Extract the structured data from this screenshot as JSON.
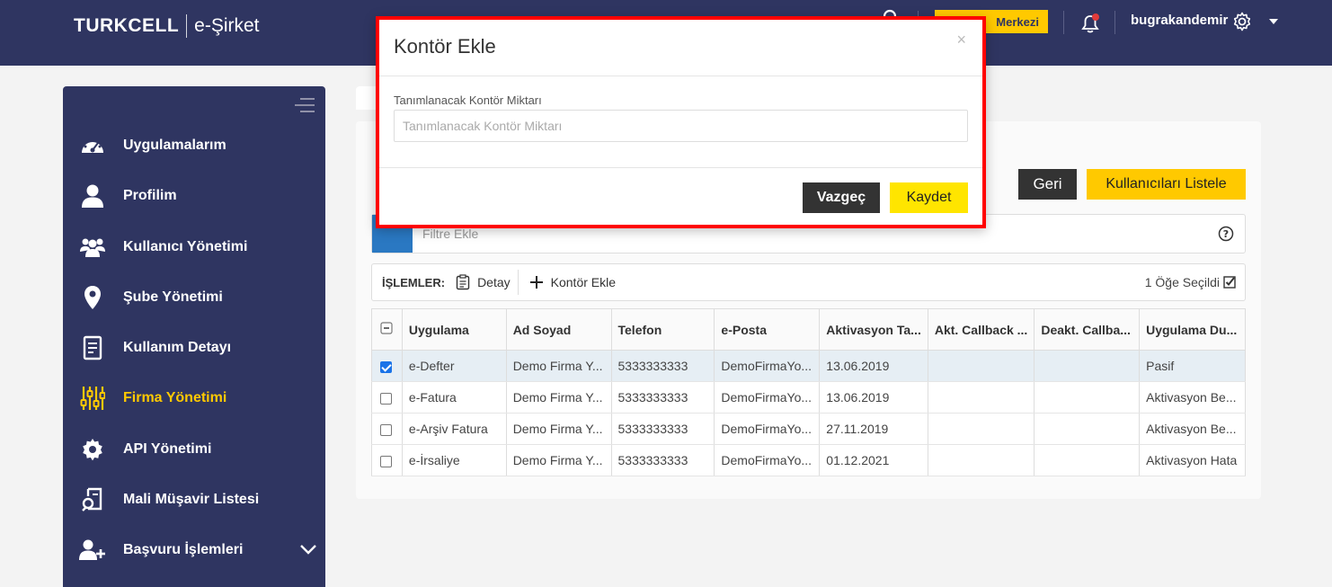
{
  "header": {
    "brand": "TURKCELL",
    "product": "e-Şirket",
    "support_label": "Merkezi",
    "username": "bugrakandemir"
  },
  "sidebar": {
    "items": [
      {
        "label": "Uygulamalarım",
        "icon": "dashboard-icon"
      },
      {
        "label": "Profilim",
        "icon": "user-icon"
      },
      {
        "label": "Kullanıcı Yönetimi",
        "icon": "users-icon"
      },
      {
        "label": "Şube Yönetimi",
        "icon": "map-pin-icon"
      },
      {
        "label": "Kullanım Detayı",
        "icon": "document-icon"
      },
      {
        "label": "Firma Yönetimi",
        "icon": "sliders-icon",
        "active": true
      },
      {
        "label": "API Yönetimi",
        "icon": "gear-icon"
      },
      {
        "label": "Mali Müşavir Listesi",
        "icon": "contract-icon"
      },
      {
        "label": "Başvuru İşlemleri",
        "icon": "user-plus-icon"
      }
    ]
  },
  "toolbar": {
    "back_label": "Geri",
    "list_users_label": "Kullanıcıları Listele",
    "filter_placeholder": "Filtre Ekle"
  },
  "operations": {
    "label": "İŞLEMLER:",
    "detail_label": "Detay",
    "add_credit_label": "Kontör Ekle",
    "selected_text": "1 Öğe Seçildi"
  },
  "table": {
    "columns": [
      "Uygulama",
      "Ad Soyad",
      "Telefon",
      "e-Posta",
      "Aktivasyon Ta...",
      "Akt. Callback ...",
      "Deakt. Callba...",
      "Uygulama Du..."
    ],
    "rows": [
      {
        "checked": true,
        "cells": [
          "e-Defter",
          "Demo Firma Y...",
          "5333333333",
          "DemoFirmaYo...",
          "13.06.2019",
          "",
          "",
          "Pasif"
        ]
      },
      {
        "checked": false,
        "cells": [
          "e-Fatura",
          "Demo Firma Y...",
          "5333333333",
          "DemoFirmaYo...",
          "13.06.2019",
          "",
          "",
          "Aktivasyon Be..."
        ]
      },
      {
        "checked": false,
        "cells": [
          "e-Arşiv Fatura",
          "Demo Firma Y...",
          "5333333333",
          "DemoFirmaYo...",
          "27.11.2019",
          "",
          "",
          "Aktivasyon Be..."
        ]
      },
      {
        "checked": false,
        "cells": [
          "e-İrsaliye",
          "Demo Firma Y...",
          "5333333333",
          "DemoFirmaYo...",
          "01.12.2021",
          "",
          "",
          "Aktivasyon Hata"
        ]
      }
    ]
  },
  "modal": {
    "title": "Kontör Ekle",
    "close_glyph": "×",
    "field_label": "Tanımlanacak Kontör Miktarı",
    "field_placeholder": "Tanımlanacak Kontör Miktarı",
    "field_value": "",
    "cancel_label": "Vazgeç",
    "save_label": "Kaydet"
  },
  "colors": {
    "navy": "#2f3561",
    "accent_yellow": "#ffc900",
    "highlight_red": "#ff0000"
  }
}
